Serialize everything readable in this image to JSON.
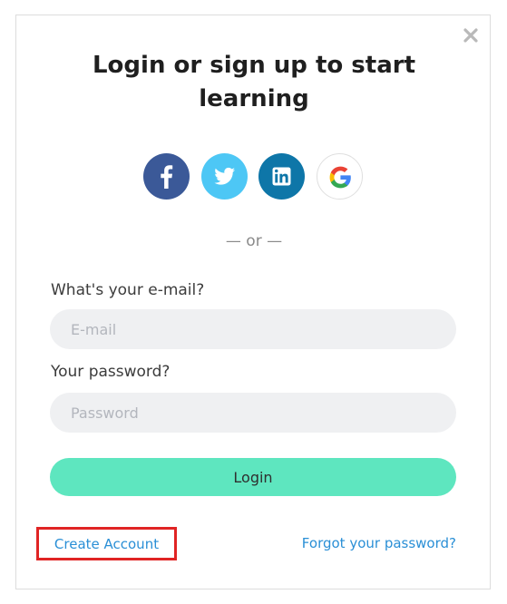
{
  "dialog": {
    "title": "Login or sign up to start learning",
    "close_icon": "close-icon"
  },
  "social": {
    "buttons": [
      {
        "name": "facebook",
        "icon": "facebook-icon",
        "color": "#3b5998"
      },
      {
        "name": "twitter",
        "icon": "twitter-icon",
        "color": "#4dc7f5"
      },
      {
        "name": "linkedin",
        "icon": "linkedin-icon",
        "color": "#0e76a8"
      },
      {
        "name": "google",
        "icon": "google-icon",
        "color": "#ffffff"
      }
    ]
  },
  "divider": {
    "text": "— or —"
  },
  "form": {
    "email_label": "What's your e-mail?",
    "email_placeholder": "E-mail",
    "email_value": "",
    "password_label": "Your password?",
    "password_placeholder": "Password",
    "password_value": "",
    "login_label": "Login"
  },
  "links": {
    "create_account": "Create Account",
    "forgot_password": "Forgot your password?"
  },
  "colors": {
    "accent": "#5ee6bf",
    "link": "#2a8fd6",
    "highlight_border": "#e02424",
    "input_bg": "#eff0f2"
  }
}
